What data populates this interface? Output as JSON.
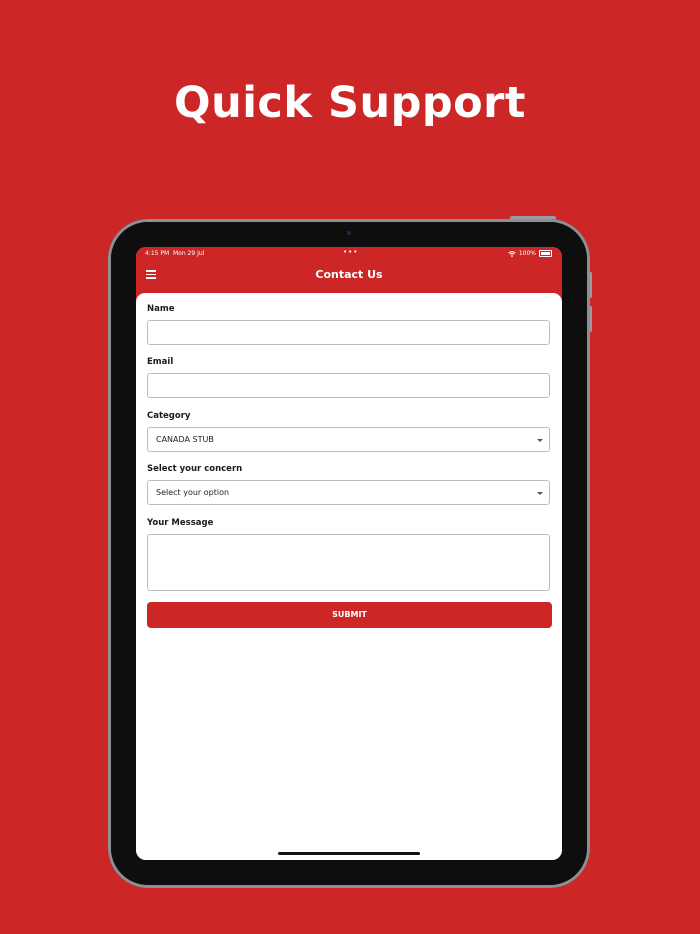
{
  "headline": "Quick Support",
  "status_bar": {
    "time": "4:15 PM",
    "date": "Mon 29 Jul",
    "dots": "•••",
    "battery": "100%",
    "wifi_icon": "wifi-icon",
    "battery_icon": "battery-icon"
  },
  "nav": {
    "title": "Contact Us",
    "menu_icon": "hamburger-menu-icon"
  },
  "form": {
    "name_label": "Name",
    "name_value": "",
    "email_label": "Email",
    "email_value": "",
    "category_label": "Category",
    "category_value": "CANADA STUB",
    "concern_label": "Select your concern",
    "concern_value": "Select your option",
    "message_label": "Your Message",
    "message_value": "",
    "submit_label": "SUBMIT"
  },
  "colors": {
    "brand_red": "#cc2627",
    "device_frame": "#111111",
    "field_border": "#bdbdbd"
  }
}
